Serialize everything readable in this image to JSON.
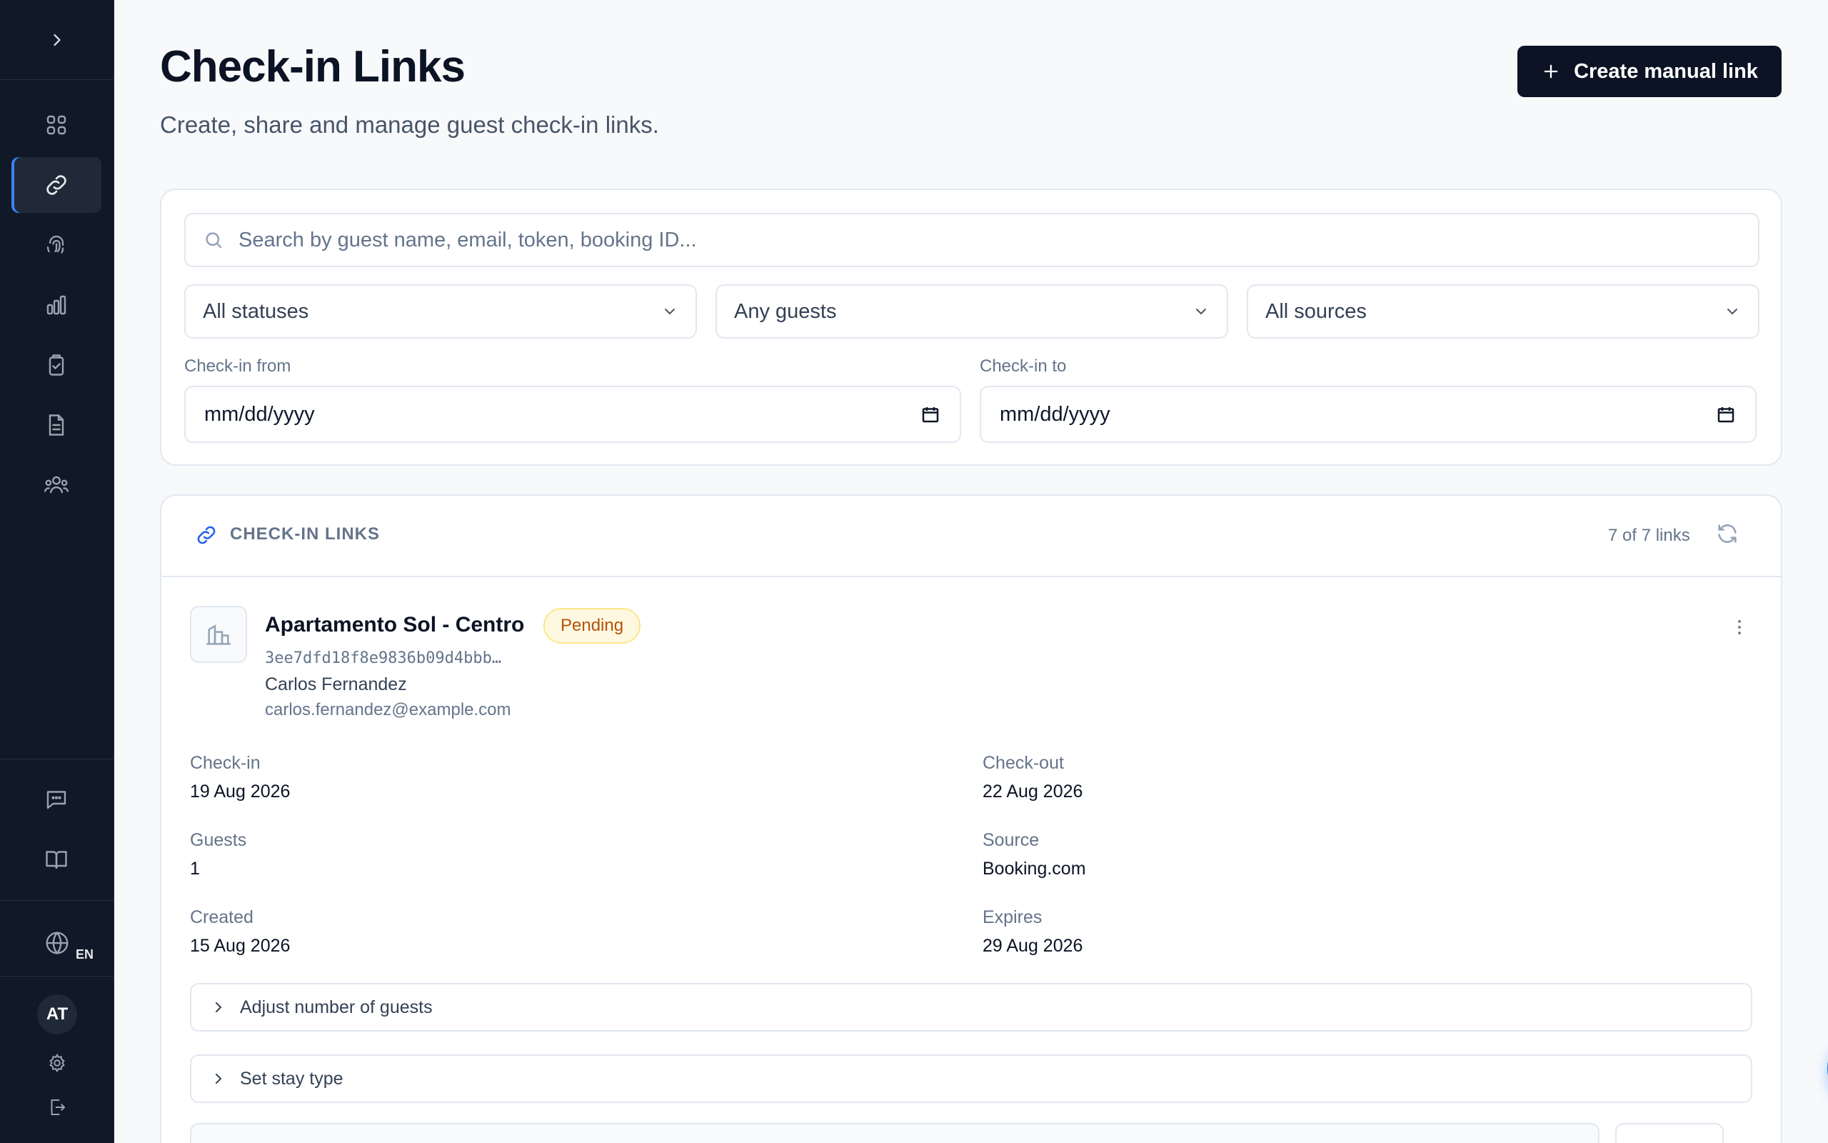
{
  "header": {
    "title": "Check-in Links",
    "subtitle": "Create, share and manage guest check-in links.",
    "create_button": "Create manual link"
  },
  "filters": {
    "search_placeholder": "Search by guest name, email, token, booking ID...",
    "status_select": "All statuses",
    "guests_select": "Any guests",
    "sources_select": "All sources",
    "checkin_from_label": "Check-in from",
    "checkin_to_label": "Check-in to",
    "date_placeholder": "mm/dd/yyyy"
  },
  "links": {
    "section_title": "CHECK-IN LINKS",
    "count": "7 of 7 links",
    "item": {
      "property": "Apartamento Sol - Centro",
      "status": "Pending",
      "token": "3ee7dfd18f8e9836b09d4bbb…",
      "guest_name": "Carlos Fernandez",
      "guest_email": "carlos.fernandez@example.com",
      "checkin_label": "Check-in",
      "checkin_value": "19 Aug 2026",
      "checkout_label": "Check-out",
      "checkout_value": "22 Aug 2026",
      "guests_label": "Guests",
      "guests_value": "1",
      "source_label": "Source",
      "source_value": "Booking.com",
      "created_label": "Created",
      "created_value": "15 Aug 2026",
      "expires_label": "Expires",
      "expires_value": "29 Aug 2026",
      "adjust_guests": "Adjust number of guests",
      "stay_type": "Set stay type"
    }
  },
  "sidebar": {
    "language": "EN",
    "avatar_initials": "AT",
    "items": [
      "dashboard-icon",
      "link-icon",
      "fingerprint-icon",
      "bar-chart-icon",
      "clipboard-check-icon",
      "document-icon",
      "users-icon",
      "chat-icon",
      "book-icon"
    ]
  },
  "colors": {
    "sidebar_bg": "#111827",
    "primary_button": "#0b1324",
    "accent": "#3b82f6",
    "pending_badge": "#b45309",
    "chat_fab": "#1677ff"
  }
}
